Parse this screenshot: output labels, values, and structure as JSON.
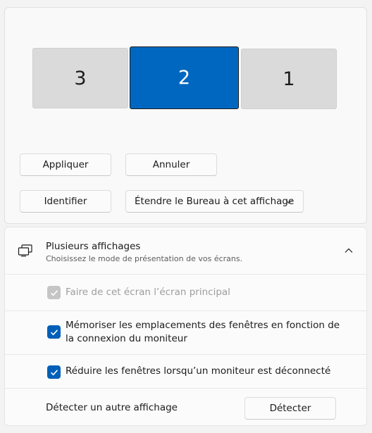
{
  "arrangement": {
    "monitors": [
      {
        "label": "3",
        "selected": false
      },
      {
        "label": "2",
        "selected": true
      },
      {
        "label": "1",
        "selected": false
      }
    ],
    "accent_color": "#0067c0"
  },
  "buttons": {
    "apply": "Appliquer",
    "cancel": "Annuler",
    "identify": "Identifier",
    "display_mode_selected": "Étendre le Bureau à cet affichage"
  },
  "multiple_displays": {
    "title": "Plusieurs affichages",
    "subtitle": "Choisissez le mode de présentation de vos écrans.",
    "expanded": true,
    "options": {
      "primary": {
        "label": "Faire de cet écran l’écran principal",
        "checked": true,
        "disabled": true
      },
      "remember": {
        "label": "Mémoriser les emplacements des fenêtres en fonction de la connexion du moniteur",
        "checked": true,
        "disabled": false
      },
      "minimize": {
        "label": "Réduire les fenêtres lorsqu’un moniteur est déconnecté",
        "checked": true,
        "disabled": false
      }
    },
    "detect": {
      "label": "Détecter un autre affichage",
      "button": "Détecter"
    }
  },
  "icons": {
    "section": "multiple-displays-icon",
    "collapse": "chevron-up-icon",
    "dropdown": "chevron-down-icon",
    "check": "checkmark-icon"
  }
}
